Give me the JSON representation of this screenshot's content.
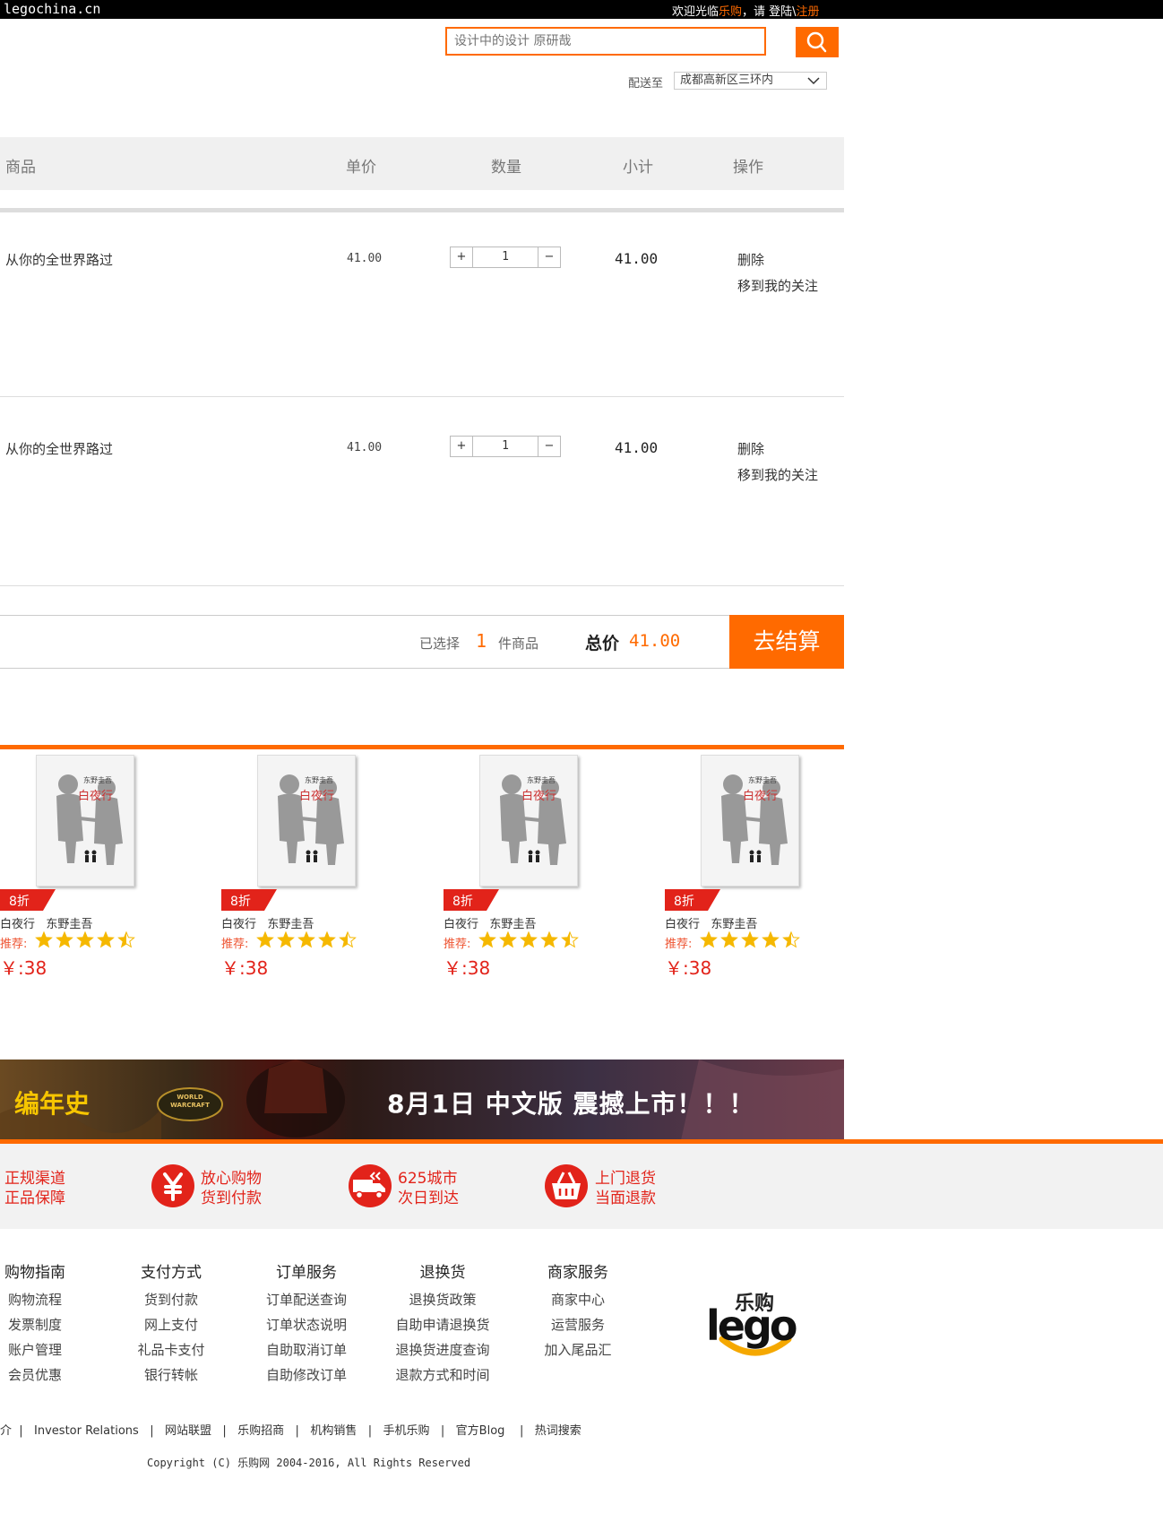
{
  "topbar": {
    "domain": "legochina.cn",
    "welcome_prefix": "欢迎光临",
    "brand": "乐购",
    "welcome_mid": "，请 登陆\\",
    "register": "注册"
  },
  "search": {
    "placeholder": "设计中的设计 原研哉"
  },
  "delivery": {
    "label": "配送至",
    "location": "成都高新区三环内"
  },
  "cart": {
    "headers": {
      "product": "商品",
      "unit_price": "单价",
      "quantity": "数量",
      "subtotal": "小计",
      "action": "操作"
    },
    "items": [
      {
        "name": "从你的全世界路过",
        "price": "41.00",
        "qty": "1",
        "subtotal": "41.00",
        "delete": "删除",
        "move": "移到我的关注"
      },
      {
        "name": "从你的全世界路过",
        "price": "41.00",
        "qty": "1",
        "subtotal": "41.00",
        "delete": "删除",
        "move": "移到我的关注"
      }
    ],
    "plus": "+",
    "minus": "−"
  },
  "summary": {
    "selected_label": "已选择",
    "count": "1",
    "unit": "件商品",
    "total_label": "总价",
    "total": "41.00",
    "checkout": "去结算"
  },
  "recommend": {
    "products": [
      {
        "discount": "8折",
        "title": "白夜行   东野圭吾",
        "rec_label": "推荐:",
        "rating": 4.5,
        "price": "￥:38",
        "book_author": "东野圭吾",
        "book_title": "白夜行"
      },
      {
        "discount": "8折",
        "title": "白夜行   东野圭吾",
        "rec_label": "推荐:",
        "rating": 4.5,
        "price": "￥:38",
        "book_author": "东野圭吾",
        "book_title": "白夜行"
      },
      {
        "discount": "8折",
        "title": "白夜行   东野圭吾",
        "rec_label": "推荐:",
        "rating": 4.5,
        "price": "￥:38",
        "book_author": "东野圭吾",
        "book_title": "白夜行"
      },
      {
        "discount": "8折",
        "title": "白夜行   东野圭吾",
        "rec_label": "推荐:",
        "rating": 4.5,
        "price": "￥:38",
        "book_author": "东野圭吾",
        "book_title": "白夜行"
      }
    ]
  },
  "banner": {
    "left_text": "编年史",
    "logo_text": "WORLD WARCRAFT",
    "main_text": "8月1日 中文版 震撼上市！！！"
  },
  "guarantees": [
    {
      "line1": "正规渠道",
      "line2": "正品保障"
    },
    {
      "line1": "放心购物",
      "line2": "货到付款"
    },
    {
      "line1": "625城市",
      "line2": "次日到达"
    },
    {
      "line1": "上门退货",
      "line2": "当面退款"
    }
  ],
  "footer_links": [
    {
      "heading": "购物指南",
      "items": [
        "购物流程",
        "发票制度",
        "账户管理",
        "会员优惠"
      ]
    },
    {
      "heading": "支付方式",
      "items": [
        "货到付款",
        "网上支付",
        "礼品卡支付",
        "银行转帐"
      ]
    },
    {
      "heading": "订单服务",
      "items": [
        "订单配送查询",
        "订单状态说明",
        "自助取消订单",
        "自助修改订单"
      ]
    },
    {
      "heading": "退换货",
      "items": [
        "退换货政策",
        "自助申请退换货",
        "退换货进度查询",
        "退款方式和时间"
      ]
    },
    {
      "heading": "商家服务",
      "items": [
        "商家中心",
        "运营服务",
        "加入尾品汇"
      ]
    }
  ],
  "logo": {
    "cn": "乐购",
    "en": "lego"
  },
  "bottom_links": "介  |   Investor Relations   |   网站联盟   |   乐购招商   |   机构销售   |   手机乐购   |   官方Blog    |   热词搜索",
  "copyright": "Copyright (C) 乐购网 2004-2016, All Rights Reserved",
  "colors": {
    "accent": "#ff6a00",
    "price_red": "#e2231a",
    "star": "#f5b800"
  }
}
